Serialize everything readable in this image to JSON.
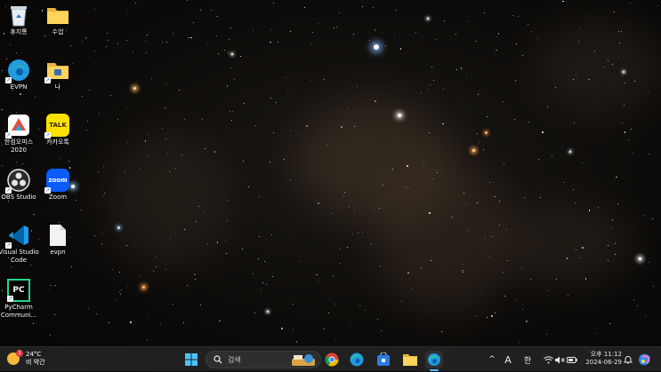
{
  "desktop": {
    "icons": [
      {
        "label": "휴지통"
      },
      {
        "label": "수업"
      },
      {
        "label": "EVPN"
      },
      {
        "label": "나"
      },
      {
        "label": "한컴오피스 2020"
      },
      {
        "label": "카카오톡"
      },
      {
        "label": "OBS Studio"
      },
      {
        "label": "Zoom"
      },
      {
        "label": "Visual Studio Code"
      },
      {
        "label": "evpn"
      },
      {
        "label": "PyCharm Communi..."
      }
    ],
    "icon_glyphs": {
      "kakao": "TALK",
      "zoom": "zoom",
      "pycharm": "PC"
    }
  },
  "taskbar": {
    "weather": {
      "badge": "1",
      "temp": "24°C",
      "condition": "비 약간"
    },
    "search_placeholder": "검색",
    "tray": {
      "chevron": "^",
      "ime_a": "A",
      "ime_han": "한"
    },
    "clock": {
      "time": "오후 11:12",
      "date": "2024-06-29"
    }
  },
  "colors": {
    "taskbar": "#202020",
    "accent": "#0078d4"
  }
}
